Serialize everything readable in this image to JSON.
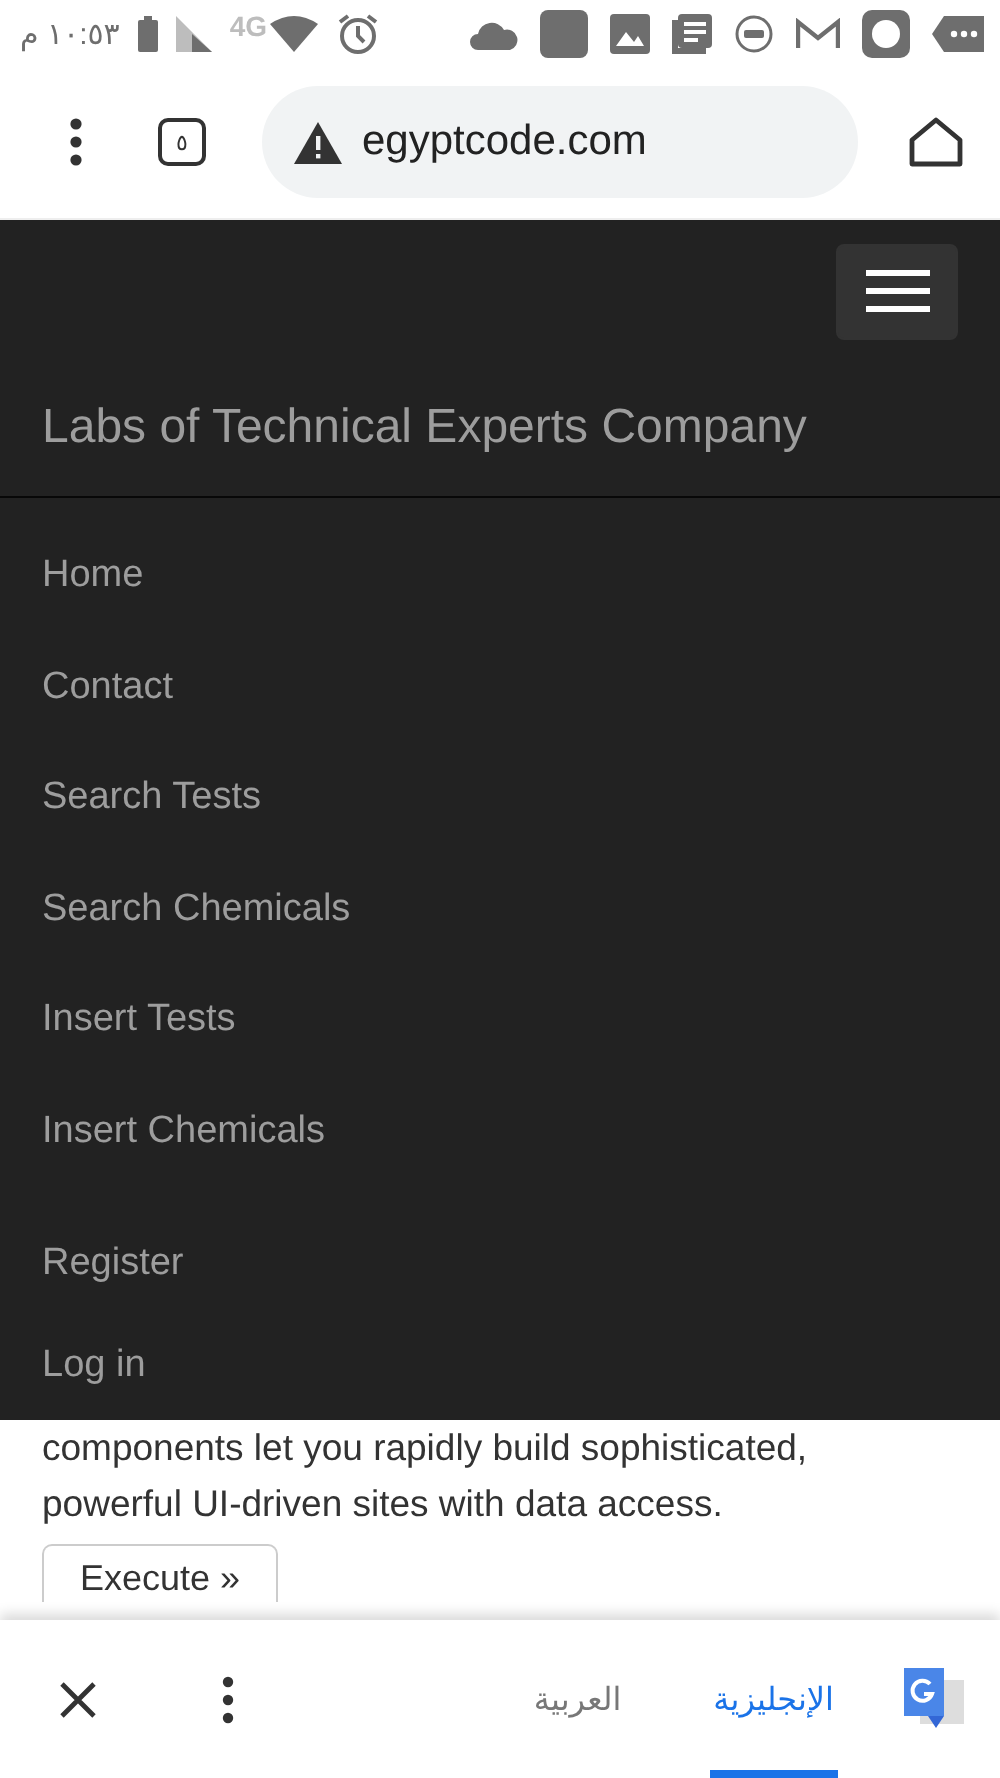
{
  "status_bar": {
    "time": "١٠:٥٣ م",
    "network": "4G"
  },
  "browser": {
    "tab_count": "٥",
    "url": "egyptcode.com"
  },
  "navbar": {
    "brand": "Labs of Technical Experts Company",
    "groups": [
      [
        "Home",
        "Contact",
        "Search Tests",
        "Search Chemicals",
        "Insert Tests",
        "Insert Chemicals"
      ],
      [
        "Register",
        "Log in"
      ]
    ]
  },
  "content": {
    "paragraph": "components let you rapidly build sophisticated, powerful UI-driven sites with data access.",
    "button": "Execute »"
  },
  "translate_bar": {
    "languages": [
      {
        "label": "الإنجليزية",
        "selected": true
      },
      {
        "label": "العربية",
        "selected": false
      }
    ]
  }
}
